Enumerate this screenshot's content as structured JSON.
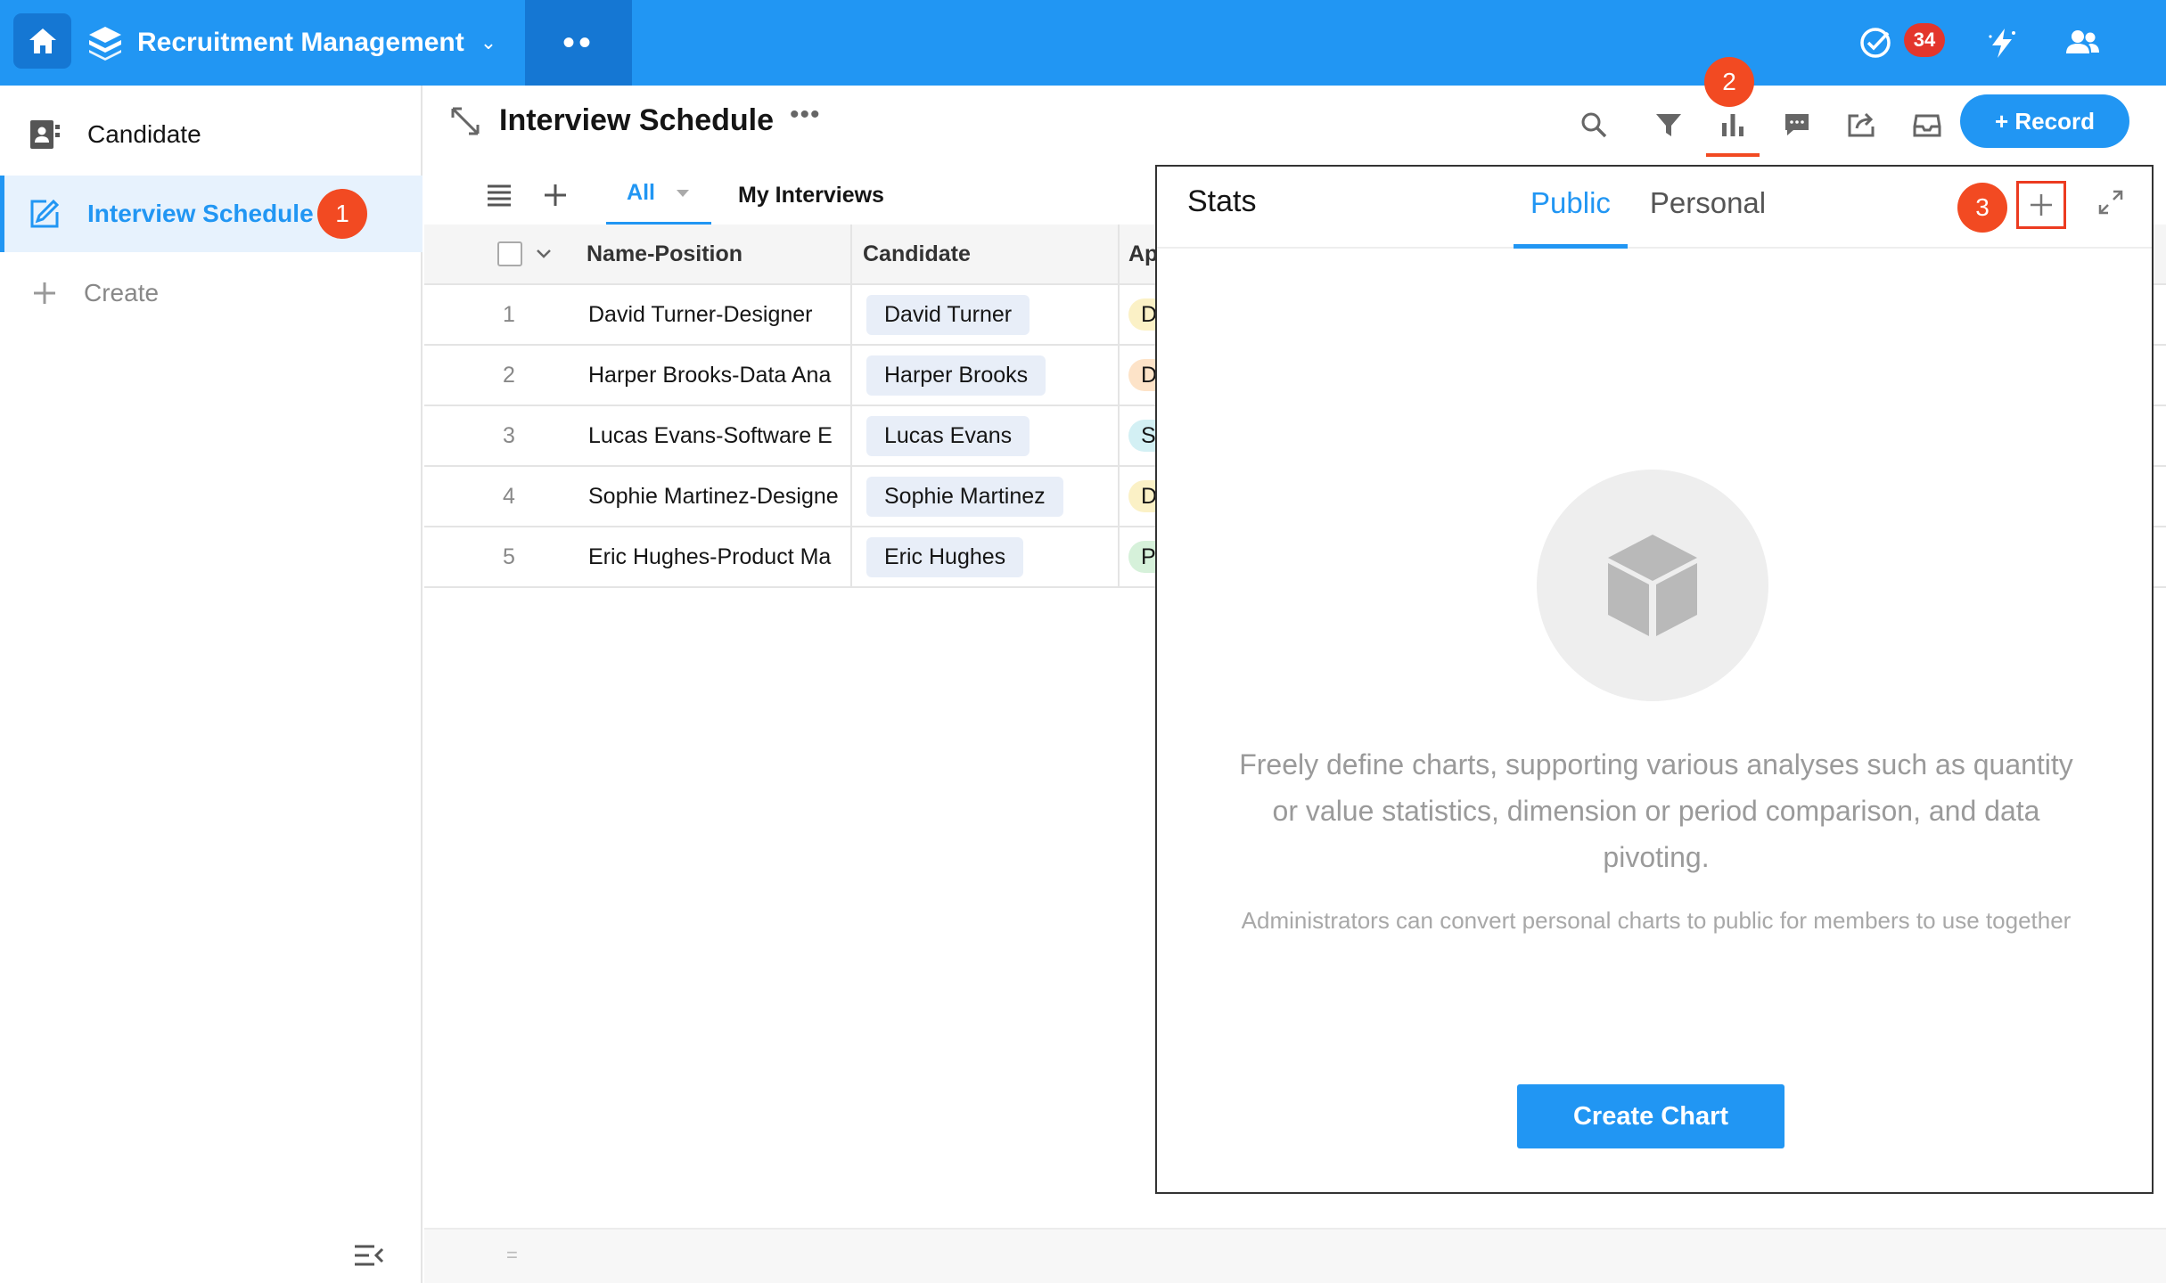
{
  "topbar": {
    "app_name": "Recruitment Management",
    "dropdown_caret": "⌄",
    "more_apps": "••",
    "notification_count": "34"
  },
  "sidebar": {
    "items": [
      {
        "label": "Candidate"
      },
      {
        "label": "Interview Schedule"
      },
      {
        "label": "Create"
      }
    ],
    "marker": "1"
  },
  "view": {
    "title": "Interview Schedule",
    "more": "•••",
    "toolbar_marker": "2",
    "record_label": "+ Record",
    "tabs": [
      "All",
      "My Interviews"
    ]
  },
  "table": {
    "columns": [
      "Name-Position",
      "Candidate",
      "Ap"
    ],
    "rows": [
      {
        "num": "1",
        "name": "David Turner-Designer",
        "candidate": "David Turner",
        "pill": "D",
        "pill_color": "#fbf1c6"
      },
      {
        "num": "2",
        "name": "Harper Brooks-Data Ana",
        "candidate": "Harper Brooks",
        "pill": "D",
        "pill_color": "#fde3c8"
      },
      {
        "num": "3",
        "name": "Lucas Evans-Software E",
        "candidate": "Lucas Evans",
        "pill": "S",
        "pill_color": "#d3f0f4"
      },
      {
        "num": "4",
        "name": "Sophie Martinez-Designe",
        "candidate": "Sophie Martinez",
        "pill": "D",
        "pill_color": "#fbf1c6"
      },
      {
        "num": "5",
        "name": "Eric Hughes-Product Ma",
        "candidate": "Eric Hughes",
        "pill": "P",
        "pill_color": "#d6f1da"
      }
    ]
  },
  "stats_panel": {
    "title": "Stats",
    "tabs": [
      "Public",
      "Personal"
    ],
    "marker": "3",
    "description": "Freely define charts, supporting various analyses such as quantity or value statistics, dimension or period comparison, and data pivoting.",
    "note": "Administrators can convert personal charts to public for members to use together",
    "create_label": "Create Chart"
  },
  "footer": {
    "handle": "="
  },
  "colors": {
    "primary": "#2196f3",
    "marker": "#f24a22",
    "badge": "#e3362c"
  }
}
